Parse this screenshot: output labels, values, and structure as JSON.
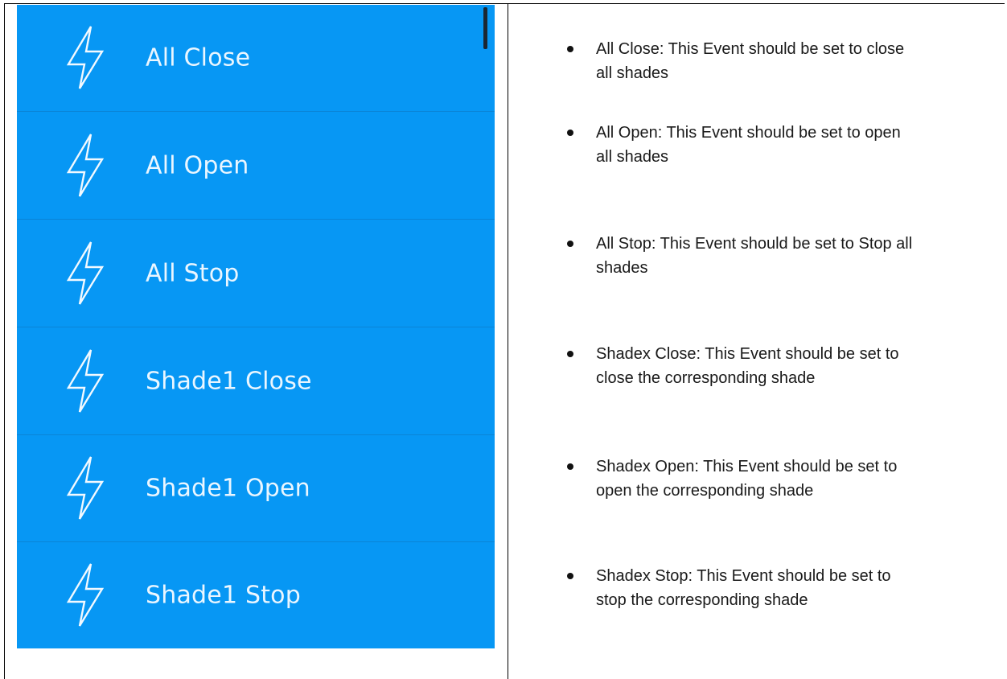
{
  "event_list": {
    "items": [
      {
        "label": "All Close",
        "icon": "lightning-bolt-icon"
      },
      {
        "label": "All Open",
        "icon": "lightning-bolt-icon"
      },
      {
        "label": "All Stop",
        "icon": "lightning-bolt-icon"
      },
      {
        "label": "Shade1 Close",
        "icon": "lightning-bolt-icon"
      },
      {
        "label": "Shade1 Open",
        "icon": "lightning-bolt-icon"
      },
      {
        "label": "Shade1 Stop",
        "icon": "lightning-bolt-icon"
      }
    ],
    "colors": {
      "background": "#0797f4",
      "text": "#eaf6ff"
    }
  },
  "descriptions": {
    "items": [
      {
        "line1": "All Close: This Event should be set to close",
        "line2": "all shades"
      },
      {
        "line1": "All Open: This Event should be set to open",
        "line2": "all shades"
      },
      {
        "line1": "All Stop: This Event should be set to Stop all",
        "line2": "shades"
      },
      {
        "line1": "Shadex Close: This Event should be set to",
        "line2": "close the corresponding shade"
      },
      {
        "line1": "Shadex Open: This Event should be set to",
        "line2": "open the corresponding shade"
      },
      {
        "line1": "Shadex Stop: This Event should be set to",
        "line2": "stop the corresponding shade"
      }
    ]
  }
}
